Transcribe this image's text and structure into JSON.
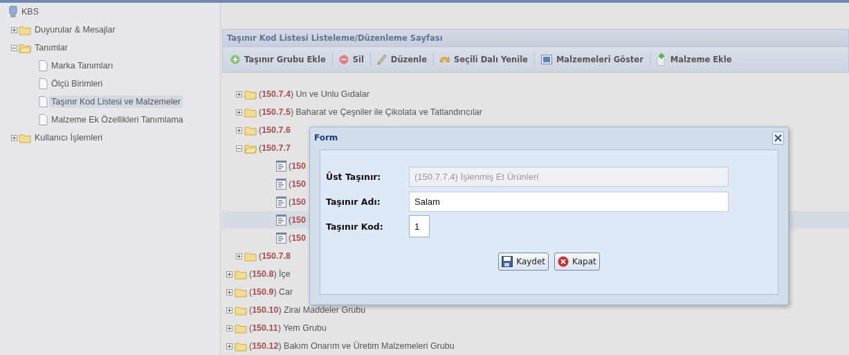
{
  "sidebar": {
    "root": "KBS",
    "items": [
      {
        "label": "Duyurular & Mesajlar",
        "expanded": false
      },
      {
        "label": "Tanımlar",
        "expanded": true,
        "children": [
          {
            "label": "Marka Tanımları",
            "selected": false
          },
          {
            "label": "Ölçü Birimleri",
            "selected": false
          },
          {
            "label": "Taşınır Kod Listesi ve Malzemeler",
            "selected": true
          },
          {
            "label": "Malzeme Ek Özellikleri Tanımlama",
            "selected": false
          }
        ]
      },
      {
        "label": "Kullanıcı İşlemleri",
        "expanded": false
      }
    ]
  },
  "panel": {
    "title": "Taşınır Kod Listesi Listeleme/Düzenleme Sayfası",
    "toolbar": [
      {
        "label": "Taşınır Grubu Ekle",
        "kind": "add"
      },
      {
        "label": "Sil",
        "kind": "delete"
      },
      {
        "label": "Düzenle",
        "kind": "edit"
      },
      {
        "label": "Seçili Dalı Yenile",
        "kind": "refresh"
      },
      {
        "label": "Malzemeleri Göster",
        "kind": "show"
      },
      {
        "label": "Malzeme Ekle",
        "kind": "new"
      }
    ],
    "tree": {
      "nested_rows": [
        {
          "prefix": "(",
          "code": "150.7.4",
          "suffix": ") Un ve Unlu Gıdalar",
          "expanded": false
        },
        {
          "prefix": "(",
          "code": "150.7.5",
          "suffix": ") Baharat ve Çeşniler ile Çikolata ve Tatlandırıcılar",
          "expanded": false
        },
        {
          "prefix": "(",
          "code": "150.7.6",
          "expanded": false
        },
        {
          "prefix": "(",
          "code": "150.7.7",
          "expanded": true,
          "children": [
            {
              "prefix": "(",
              "code": "150",
              "selected": false
            },
            {
              "prefix": "(",
              "code": "150",
              "selected": false
            },
            {
              "prefix": "(",
              "code": "150",
              "selected": false
            },
            {
              "prefix": "(",
              "code": "150",
              "selected": true
            },
            {
              "prefix": "(",
              "code": "150",
              "selected": false
            }
          ]
        },
        {
          "prefix": "(",
          "code": "150.7.8",
          "expanded": false
        }
      ],
      "rows": [
        {
          "prefix": "(",
          "code": "150.8",
          "suffix": ") İçe",
          "expanded": false
        },
        {
          "prefix": "(",
          "code": "150.9",
          "suffix": ") Car",
          "expanded": false
        },
        {
          "prefix": "(",
          "code": "150.10",
          "suffix": ") Zirai Maddeler Grubu",
          "expanded": false
        },
        {
          "prefix": "(",
          "code": "150.11",
          "suffix": ") Yem Grubu",
          "expanded": false
        },
        {
          "prefix": "(",
          "code": "150.12",
          "suffix": ") Bakım Onarım ve Üretim Malzemeleri Grubu",
          "expanded": false
        }
      ]
    }
  },
  "dialog": {
    "title": "Form",
    "fields": [
      {
        "label": "Üst Taşınır:",
        "value": "(150.7.7.4) İşlenmiş Et Ürünleri",
        "disabled": true,
        "kind": "wide"
      },
      {
        "label": "Taşınır Adı:",
        "value": "Salam",
        "disabled": false,
        "kind": "wide"
      },
      {
        "label": "Taşınır Kod:",
        "value": "1",
        "disabled": false,
        "kind": "short"
      }
    ],
    "buttons": [
      {
        "label": "Kaydet",
        "kind": "save"
      },
      {
        "label": "Kapat",
        "kind": "close"
      }
    ]
  }
}
